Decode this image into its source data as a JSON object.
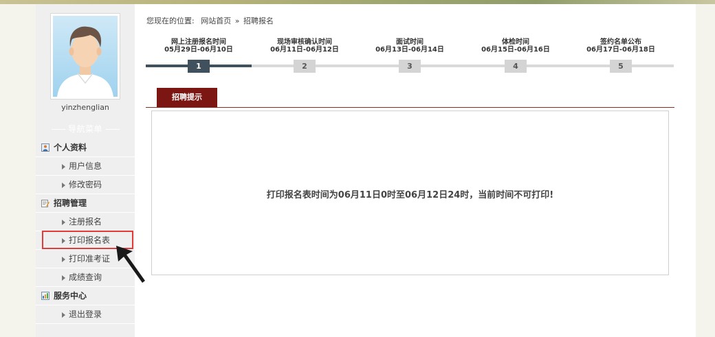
{
  "user": {
    "username": "yinzhenglian"
  },
  "sidebar": {
    "nav_title": "导航菜单",
    "groups": [
      {
        "label": "个人资料",
        "items": [
          {
            "label": "用户信息"
          },
          {
            "label": "修改密码"
          }
        ]
      },
      {
        "label": "招聘管理",
        "items": [
          {
            "label": "注册报名"
          },
          {
            "label": "打印报名表"
          },
          {
            "label": "打印准考证"
          },
          {
            "label": "成绩查询"
          }
        ]
      },
      {
        "label": "服务中心",
        "items": [
          {
            "label": "退出登录"
          }
        ]
      }
    ]
  },
  "breadcrumb": {
    "prefix": "您现在的位置:",
    "home": "网站首页",
    "separator": "»",
    "current": "招聘报名"
  },
  "steps": [
    {
      "title": "网上注册报名时间",
      "dates": "05月29日-06月10日",
      "number": "1",
      "active": true
    },
    {
      "title": "现场审核确认时间",
      "dates": "06月11日-06月12日",
      "number": "2",
      "active": false
    },
    {
      "title": "面试时间",
      "dates": "06月13日-06月14日",
      "number": "3",
      "active": false
    },
    {
      "title": "体检时间",
      "dates": "06月15日-06月16日",
      "number": "4",
      "active": false
    },
    {
      "title": "签约名单公布",
      "dates": "06月17日-06月18日",
      "number": "5",
      "active": false
    }
  ],
  "tab": {
    "label": "招聘提示"
  },
  "message": "打印报名表时间为06月11日0时至06月12日24时，当前时间不可打印!",
  "colors": {
    "tab_bg": "#7b1612",
    "step_active": "#40505c",
    "highlight": "#e33a3a",
    "sidebar_bg": "#efefef"
  },
  "icons": {
    "group_icons": [
      "user-profile-icon",
      "recruit-manage-icon",
      "service-center-icon"
    ],
    "item_icon": "caret-right-icon"
  }
}
